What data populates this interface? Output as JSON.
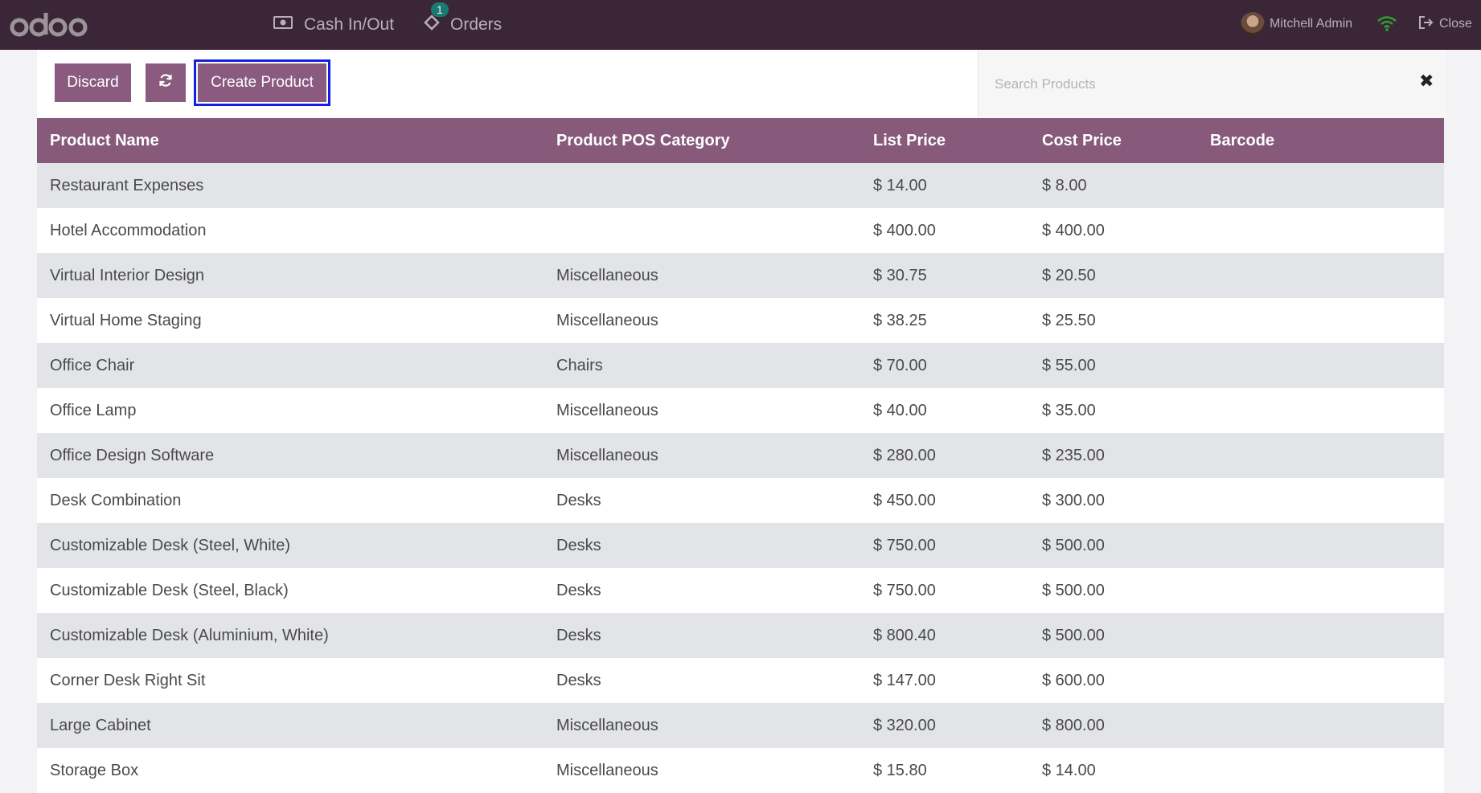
{
  "navbar": {
    "cash_label": "Cash In/Out",
    "orders_label": "Orders",
    "orders_badge": "1",
    "user_name": "Mitchell Admin",
    "close_label": "Close"
  },
  "controls": {
    "discard_label": "Discard",
    "refresh_icon": "refresh-icon",
    "create_label": "Create Product"
  },
  "search": {
    "placeholder": "Search Products",
    "clear_icon": "close-icon"
  },
  "table": {
    "headers": [
      "Product Name",
      "Product POS Category",
      "List Price",
      "Cost Price",
      "Barcode"
    ],
    "rows": [
      {
        "name": "Restaurant Expenses",
        "category": "",
        "list": "$ 14.00",
        "cost": "$ 8.00",
        "barcode": ""
      },
      {
        "name": "Hotel Accommodation",
        "category": "",
        "list": "$ 400.00",
        "cost": "$ 400.00",
        "barcode": ""
      },
      {
        "name": "Virtual Interior Design",
        "category": "Miscellaneous",
        "list": "$ 30.75",
        "cost": "$ 20.50",
        "barcode": ""
      },
      {
        "name": "Virtual Home Staging",
        "category": "Miscellaneous",
        "list": "$ 38.25",
        "cost": "$ 25.50",
        "barcode": ""
      },
      {
        "name": "Office Chair",
        "category": "Chairs",
        "list": "$ 70.00",
        "cost": "$ 55.00",
        "barcode": ""
      },
      {
        "name": "Office Lamp",
        "category": "Miscellaneous",
        "list": "$ 40.00",
        "cost": "$ 35.00",
        "barcode": ""
      },
      {
        "name": "Office Design Software",
        "category": "Miscellaneous",
        "list": "$ 280.00",
        "cost": "$ 235.00",
        "barcode": ""
      },
      {
        "name": "Desk Combination",
        "category": "Desks",
        "list": "$ 450.00",
        "cost": "$ 300.00",
        "barcode": ""
      },
      {
        "name": "Customizable Desk (Steel, White)",
        "category": "Desks",
        "list": "$ 750.00",
        "cost": "$ 500.00",
        "barcode": ""
      },
      {
        "name": "Customizable Desk (Steel, Black)",
        "category": "Desks",
        "list": "$ 750.00",
        "cost": "$ 500.00",
        "barcode": ""
      },
      {
        "name": "Customizable Desk (Aluminium, White)",
        "category": "Desks",
        "list": "$ 800.40",
        "cost": "$ 500.00",
        "barcode": ""
      },
      {
        "name": "Corner Desk Right Sit",
        "category": "Desks",
        "list": "$ 147.00",
        "cost": "$ 600.00",
        "barcode": ""
      },
      {
        "name": "Large Cabinet",
        "category": "Miscellaneous",
        "list": "$ 320.00",
        "cost": "$ 800.00",
        "barcode": ""
      },
      {
        "name": "Storage Box",
        "category": "Miscellaneous",
        "list": "$ 15.80",
        "cost": "$ 14.00",
        "barcode": ""
      }
    ]
  }
}
